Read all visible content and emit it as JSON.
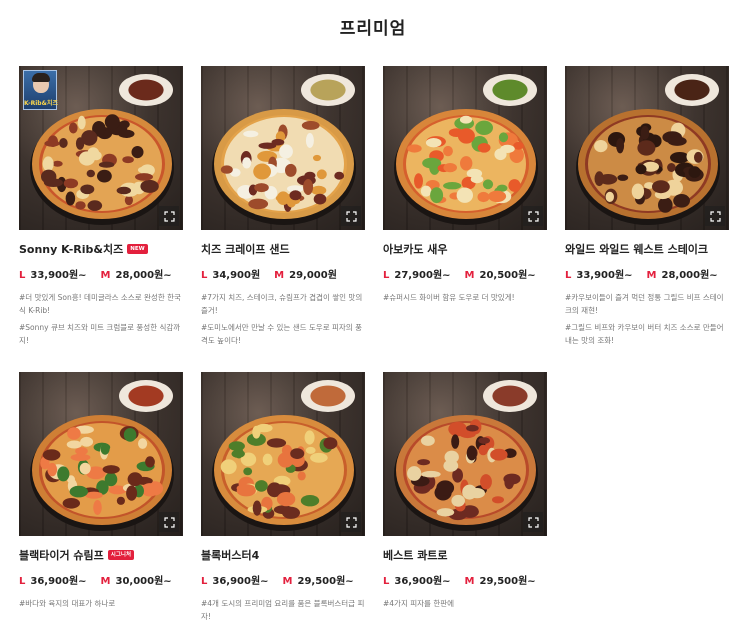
{
  "page": {
    "title": "프리미엄"
  },
  "products": [
    {
      "name": "Sonny K-Rib&치즈",
      "badge": "NEW",
      "badge_color": "#e3203d",
      "prices": [
        {
          "size": "L",
          "price": "33,900원~"
        },
        {
          "size": "M",
          "price": "28,000원~"
        }
      ],
      "descriptions": [
        "#더 맛있게 Son흥! 데미글라스 소스로 완성한 한국식 K-Rib!",
        "#Sonny 큐브 치즈와 미트 크럼블로 풍성한 식감까지!"
      ],
      "image_badge": {
        "text": "K-Rib&치즈"
      }
    },
    {
      "name": "치즈 크레이프 샌드",
      "prices": [
        {
          "size": "L",
          "price": "34,900원"
        },
        {
          "size": "M",
          "price": "29,000원"
        }
      ],
      "descriptions": [
        "#7가지 치즈, 스테이크, 슈림프가 겹겹이 쌓인 맛의 즐거!",
        "#도미노에서만 만날 수 있는 샌드 도우로 피자의 풍격도 높이다!"
      ]
    },
    {
      "name": "아보카도 새우",
      "prices": [
        {
          "size": "L",
          "price": "27,900원~"
        },
        {
          "size": "M",
          "price": "20,500원~"
        }
      ],
      "descriptions": [
        "#슈퍼시드 화이버 함유 도우로 더 맛있게!"
      ]
    },
    {
      "name": "와일드 와일드 웨스트 스테이크",
      "prices": [
        {
          "size": "L",
          "price": "33,900원~"
        },
        {
          "size": "M",
          "price": "28,000원~"
        }
      ],
      "descriptions": [
        "#카우보이들이 즐겨 먹던 정통 그릴드 비프 스테이크의 재현!",
        "#그릴드 비프와 카우보이 버터 치즈 소스로 만들어내는 맛의 조화!"
      ]
    },
    {
      "name": "블랙타이거 슈림프",
      "badge": "시그니처",
      "badge_color": "#e3203d",
      "prices": [
        {
          "size": "L",
          "price": "36,900원~"
        },
        {
          "size": "M",
          "price": "30,000원~"
        }
      ],
      "descriptions": [
        "#바다와 육지의 대표가 하나로"
      ]
    },
    {
      "name": "블록버스터4",
      "prices": [
        {
          "size": "L",
          "price": "36,900원~"
        },
        {
          "size": "M",
          "price": "29,500원~"
        }
      ],
      "descriptions": [
        "#4개 도시의 프리미엄 요리를 품은 블록버스터급 피자!"
      ]
    },
    {
      "name": "베스트 콰트로",
      "prices": [
        {
          "size": "L",
          "price": "36,900원~"
        },
        {
          "size": "M",
          "price": "29,500원~"
        }
      ],
      "descriptions": [
        "#4가지 피자를 한판에"
      ]
    }
  ],
  "icons": {
    "zoom": "expand-icon"
  },
  "colors": {
    "accent": "#e3203d",
    "text": "#222222",
    "muted": "#777777"
  }
}
